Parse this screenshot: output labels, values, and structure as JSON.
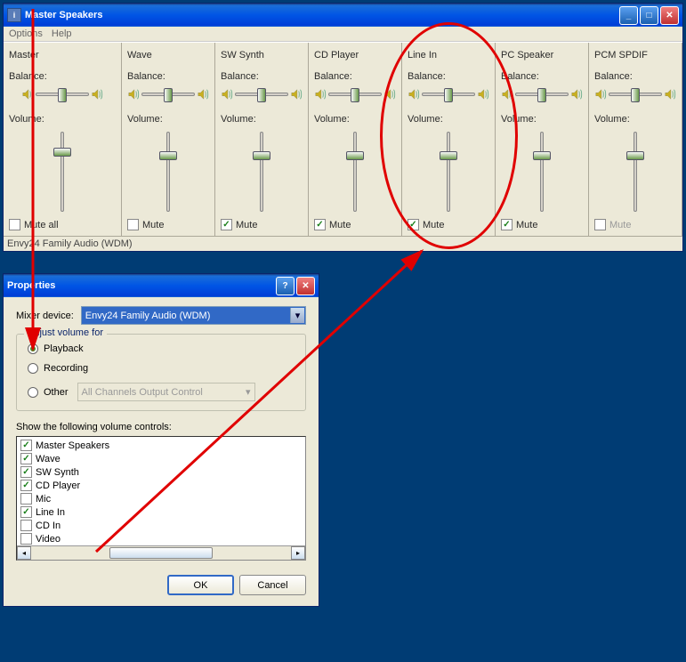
{
  "mixer_window": {
    "title": "Master Speakers",
    "menu": {
      "options": "Options",
      "help": "Help"
    },
    "status": "Envy24 Family Audio (WDM)",
    "labels": {
      "balance": "Balance:",
      "volume": "Volume:",
      "mute": "Mute",
      "mute_all": "Mute all"
    },
    "channels": [
      {
        "name": "Master",
        "mute_label_key": "mute_all",
        "muted": false,
        "vol": 78,
        "disabled": false
      },
      {
        "name": "Wave",
        "mute_label_key": "mute",
        "muted": false,
        "vol": 72,
        "disabled": false
      },
      {
        "name": "SW Synth",
        "mute_label_key": "mute",
        "muted": true,
        "vol": 72,
        "disabled": false
      },
      {
        "name": "CD Player",
        "mute_label_key": "mute",
        "muted": true,
        "vol": 72,
        "disabled": false
      },
      {
        "name": "Line In",
        "mute_label_key": "mute",
        "muted": true,
        "vol": 72,
        "disabled": false
      },
      {
        "name": "PC Speaker",
        "mute_label_key": "mute",
        "muted": true,
        "vol": 72,
        "disabled": false
      },
      {
        "name": "PCM SPDIF",
        "mute_label_key": "mute",
        "muted": false,
        "vol": 72,
        "disabled": true
      }
    ]
  },
  "properties_dialog": {
    "title": "Properties",
    "mixer_device_label": "Mixer device:",
    "mixer_device": "Envy24 Family Audio (WDM)",
    "group_title": "Adjust volume for",
    "radios": {
      "playback": "Playback",
      "recording": "Recording",
      "other": "Other",
      "other_value": "All Channels Output Control"
    },
    "selected_radio": "playback",
    "list_label": "Show the following volume controls:",
    "controls": [
      {
        "label": "Master Speakers",
        "checked": true
      },
      {
        "label": "Wave",
        "checked": true
      },
      {
        "label": "SW Synth",
        "checked": true
      },
      {
        "label": "CD Player",
        "checked": true
      },
      {
        "label": "Mic",
        "checked": false
      },
      {
        "label": "Line In",
        "checked": true
      },
      {
        "label": "CD In",
        "checked": false
      },
      {
        "label": "Video",
        "checked": false
      }
    ],
    "buttons": {
      "ok": "OK",
      "cancel": "Cancel"
    }
  }
}
